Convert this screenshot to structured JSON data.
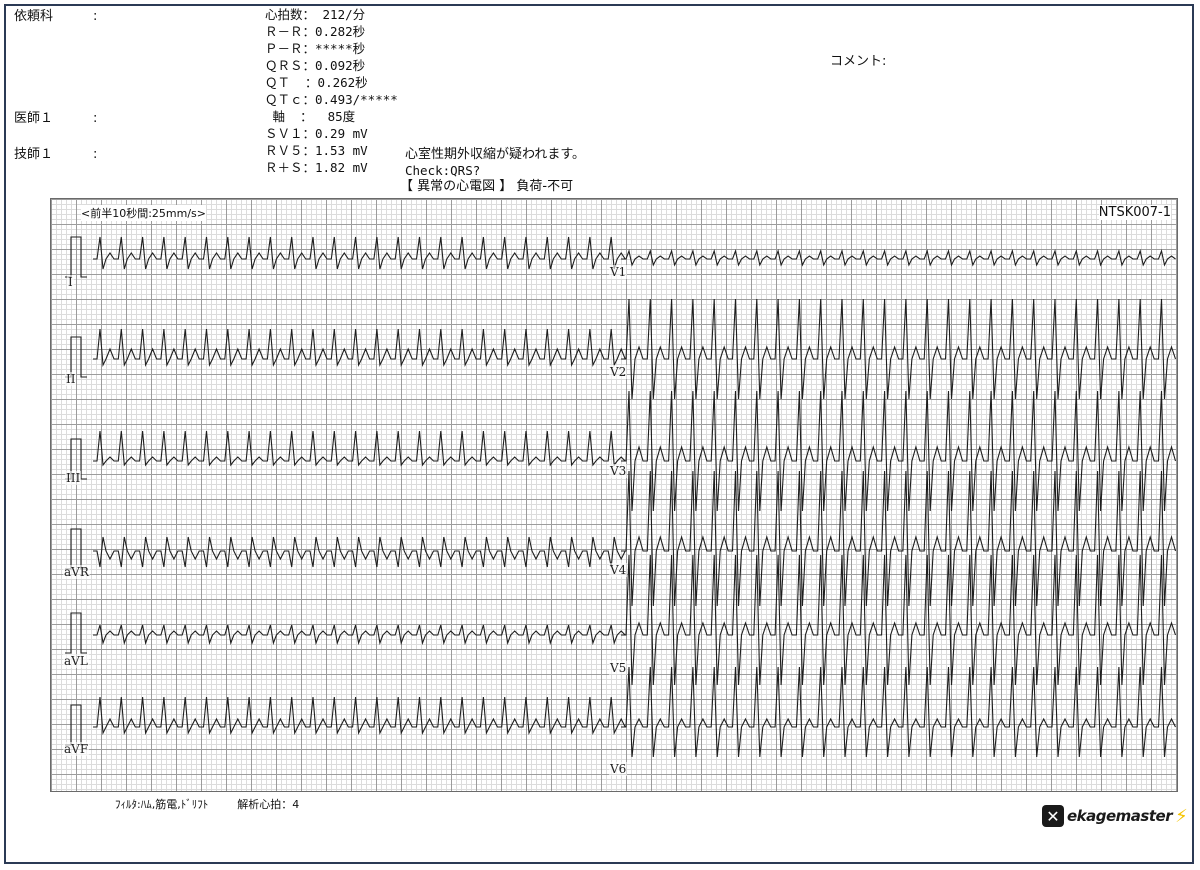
{
  "header": {
    "left": [
      {
        "label": "依頼科",
        "colon": ":"
      },
      {
        "label": "医師１",
        "colon": ":"
      },
      {
        "label": "技師１",
        "colon": ":"
      }
    ],
    "measurements": [
      "心拍数： 212/分",
      "Ｒ－Ｒ：0.282秒",
      "Ｐ－Ｒ：*****秒",
      "ＱＲＳ：0.092秒",
      "ＱＴ  ：0.262秒",
      "ＱＴｃ：0.493/*****",
      " 軸  ：  85度",
      "ＳＶ１：0.29 mV",
      "ＲＶ５：1.53 mV",
      "Ｒ＋Ｓ：1.82 mV"
    ],
    "interpretation_1": "心室性期外収縮が疑われます。",
    "interpretation_2": "Check:QRS?",
    "verdict": "【 異常の心電図 】 負荷-不可",
    "comment_label": "コメント:"
  },
  "ecg": {
    "speed_label": "<前半10秒間:25mm/s>",
    "record_code": "NTSK007-1",
    "leads_left": [
      "I",
      "II",
      "III",
      "aVR",
      "aVL",
      "aVF"
    ],
    "leads_right": [
      "V1",
      "V2",
      "V3",
      "V4",
      "V5",
      "V6"
    ],
    "heart_rate_bpm": 212,
    "grid_major_color": "#9c9c9c",
    "grid_minor_color": "#dcdcdc",
    "trace_color": "#1e1e1e"
  },
  "footer": {
    "filter": "ﾌｨﾙﾀ:ﾊﾑ,筋電,ﾄﾞﾘﾌﾄ",
    "analysis": "解析心拍：4"
  },
  "logo": {
    "icon": "x-icon",
    "text": "ekagemaster",
    "bolt_icon": "lightning-bolt-icon"
  }
}
